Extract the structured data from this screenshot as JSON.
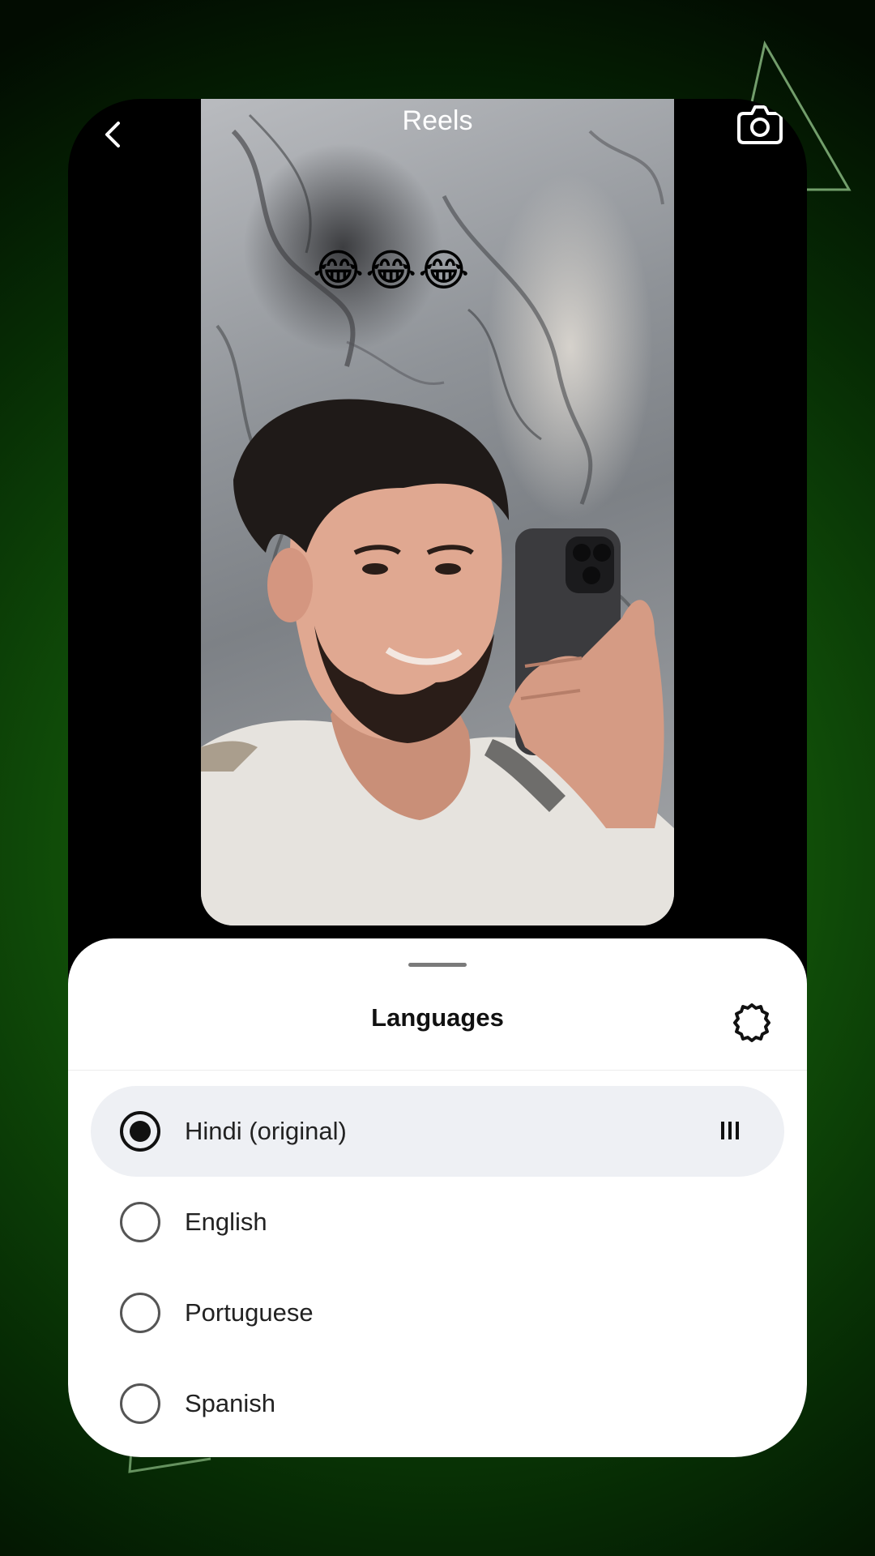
{
  "header": {
    "title": "Reels",
    "back_icon": "chevron-left-icon",
    "camera_icon": "camera-icon"
  },
  "video": {
    "overlay_text": "😂😂😂"
  },
  "sheet": {
    "title": "Languages",
    "settings_icon": "gear-icon",
    "languages": [
      {
        "label": "Hindi (original)",
        "selected": true,
        "playing": true
      },
      {
        "label": "English",
        "selected": false
      },
      {
        "label": "Portuguese",
        "selected": false
      },
      {
        "label": "Spanish",
        "selected": false
      }
    ]
  },
  "colors": {
    "background_green": "#1f7a10",
    "sheet_bg": "#ffffff",
    "selected_row_bg": "#eef0f4"
  }
}
